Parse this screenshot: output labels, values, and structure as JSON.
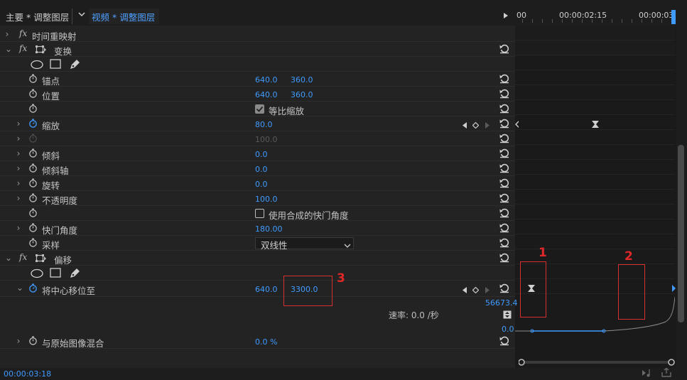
{
  "header": {
    "master_tab": "主要 * 调整图层",
    "sequence_tab": "视频 * 调整图层"
  },
  "timeline": {
    "time_start": "00",
    "time_mid": "00:00:02:15",
    "time_end": "00:00:03"
  },
  "effects": {
    "time_remap": "时间重映射",
    "transform": {
      "label": "变换",
      "anchor": {
        "label": "锚点",
        "x": "640.0",
        "y": "360.0"
      },
      "position": {
        "label": "位置",
        "x": "640.0",
        "y": "360.0"
      },
      "uniform_scale": "等比缩放",
      "scale": {
        "label": "缩放",
        "value": "80.0"
      },
      "scale_width": {
        "value": "100.0"
      },
      "skew": {
        "label": "倾斜",
        "value": "0.0"
      },
      "skew_axis": {
        "label": "倾斜轴",
        "value": "0.0"
      },
      "rotation": {
        "label": "旋转",
        "value": "0.0"
      },
      "opacity": {
        "label": "不透明度",
        "value": "100.0"
      },
      "use_comp_shutter": "使用合成的快门角度",
      "shutter_angle": {
        "label": "快门角度",
        "value": "180.00"
      },
      "sampling": {
        "label": "采样",
        "value": "双线性"
      }
    },
    "offset": {
      "label": "偏移",
      "shift_center": {
        "label": "将中心移位至",
        "x": "640.0",
        "y": "3300.0"
      },
      "graph_max": "56673.4",
      "graph_min": "0.0",
      "velocity_label": "速率: 0.0 /秒",
      "blend": {
        "label": "与原始图像混合",
        "value": "0.0 %"
      }
    }
  },
  "annotations": {
    "one": "1",
    "two": "2",
    "three": "3"
  },
  "footer": {
    "timecode": "00:00:03:18"
  },
  "colors": {
    "accent": "#3f9bff",
    "annotation": "#d63030",
    "panel": "#232323"
  }
}
